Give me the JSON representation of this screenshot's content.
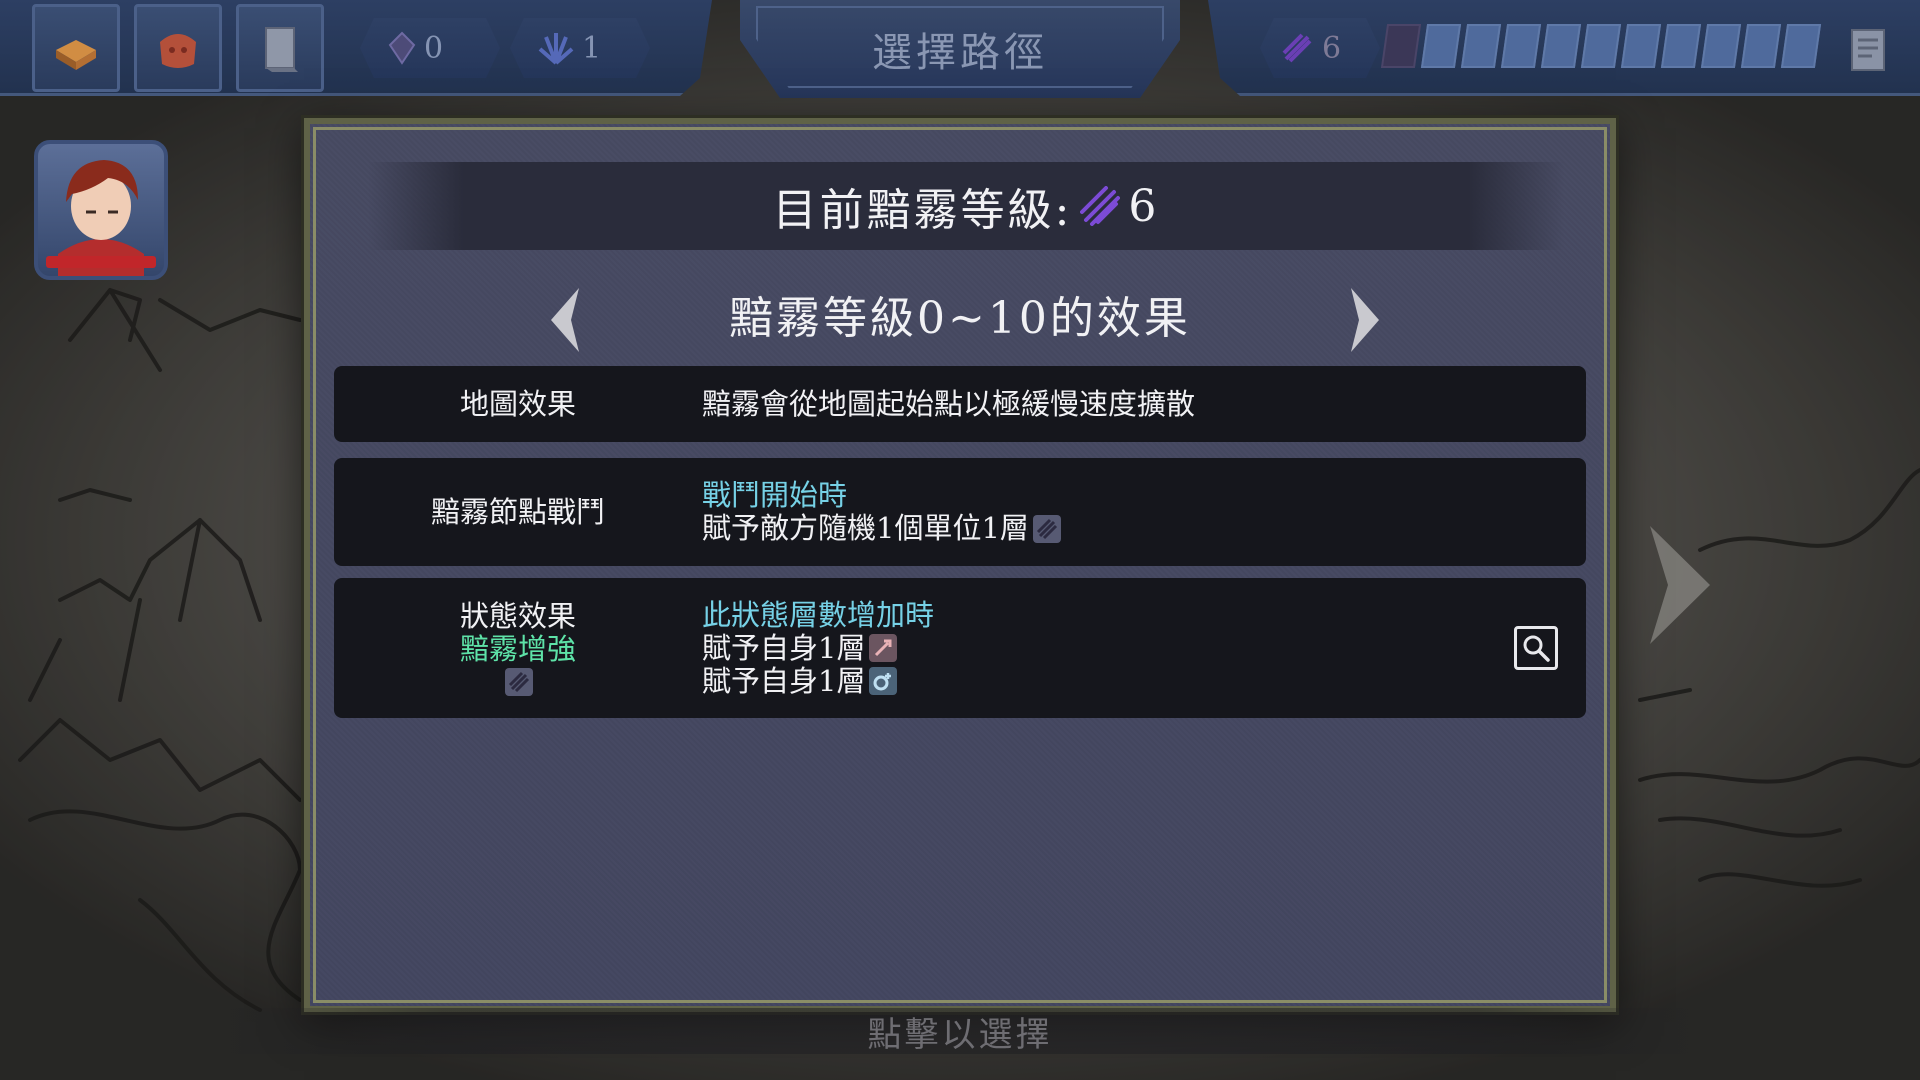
{
  "hud": {
    "title": "選擇路徑",
    "crystal_count": "0",
    "plant_count": "1",
    "fog_level": "6",
    "fog_track_total": 11,
    "fog_track_filled": 1
  },
  "dialog": {
    "level_label": "目前黯霧等級:",
    "level_value": "6",
    "range_title": "黯霧等級0~10的效果",
    "rows": [
      {
        "label": "地圖效果",
        "lines": [
          "黯霧會從地圖起始點以極緩慢速度擴散"
        ]
      },
      {
        "label": "黯霧節點戰鬥",
        "trigger": "戰鬥開始時",
        "lines": [
          "賦予敵方隨機1個單位1層"
        ]
      },
      {
        "label": "狀態效果",
        "status_name": "黯霧增強",
        "trigger": "此狀態層數增加時",
        "lines": [
          "賦予自身1層",
          "賦予自身1層"
        ]
      }
    ]
  },
  "bottom_hint": "點擊以選擇",
  "colors": {
    "cyan_text": "#76d1e6",
    "green_text": "#5ee3a8",
    "hud_blue": "#2d3f63",
    "fog_purple": "#7c4bd6"
  },
  "icons": {
    "fog": "fog-icon",
    "attack_up": "attack-up-icon",
    "defense_up": "defense-up-icon",
    "zoom": "magnifier-icon"
  }
}
